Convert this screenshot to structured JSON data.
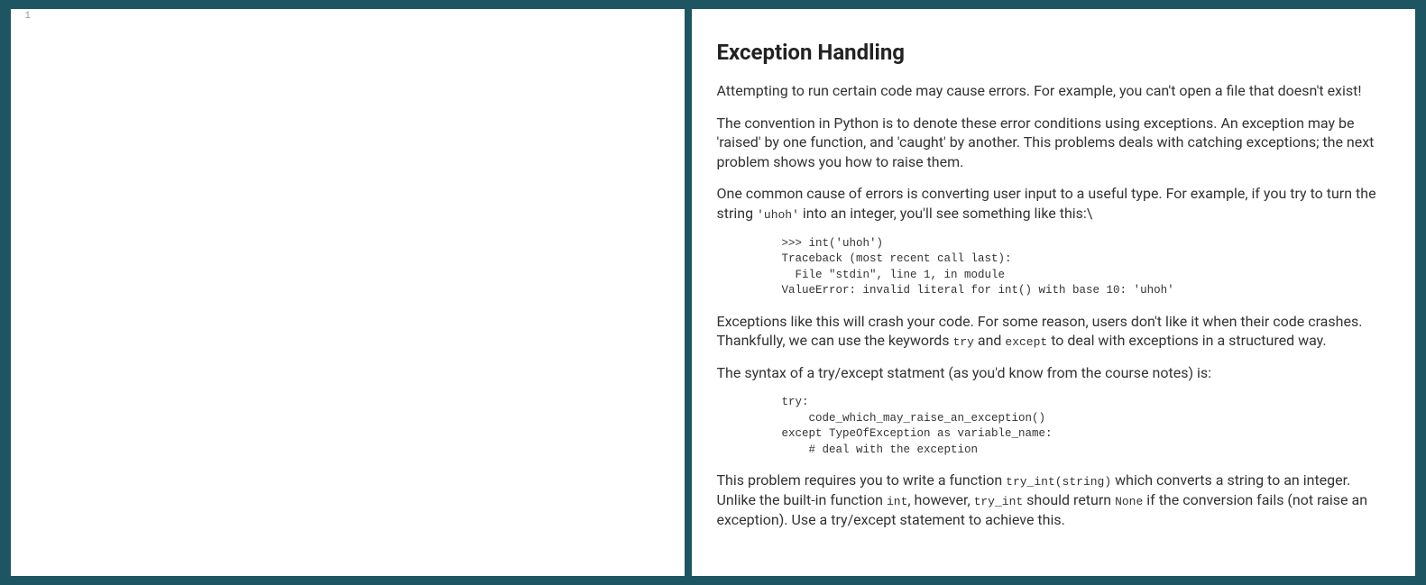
{
  "editor": {
    "line_number": "1"
  },
  "doc": {
    "title": "Exception Handling",
    "para1": "Attempting to run certain code may cause errors. For example, you can't open a file that doesn't exist!",
    "para2": "The convention in Python is to denote these error conditions using exceptions. An exception may be 'raised' by one function, and 'caught' by another. This problems deals with catching exceptions; the next problem shows you how to raise them.",
    "para3_a": "One common cause of errors is converting user input to a useful type. For example, if you try to turn the string ",
    "para3_code": "'uhoh'",
    "para3_b": " into an integer, you'll see something like this:\\",
    "code1": ">>> int('uhoh')\nTraceback (most recent call last):\n  File \"stdin\", line 1, in module\nValueError: invalid literal for int() with base 10: 'uhoh'",
    "para4_a": "Exceptions like this will crash your code. For some reason, users don't like it when their code crashes. Thankfully, we can use the keywords ",
    "para4_code1": "try",
    "para4_b": " and ",
    "para4_code2": "except",
    "para4_c": " to deal with exceptions in a structured way.",
    "para5": "The syntax of a try/except statment (as you'd know from the course notes) is:",
    "code2": "try:\n    code_which_may_raise_an_exception()\nexcept TypeOfException as variable_name:\n    # deal with the exception",
    "para6_a": "This problem requires you to write a function ",
    "para6_code1": "try_int(string)",
    "para6_b": " which converts a string to an integer. Unlike the built-in function ",
    "para6_code2": "int",
    "para6_c": ", however, ",
    "para6_code3": "try_int",
    "para6_d": " should return ",
    "para6_code4": "None",
    "para6_e": " if the conversion fails (not raise an exception). Use a try/except statement to achieve this."
  }
}
